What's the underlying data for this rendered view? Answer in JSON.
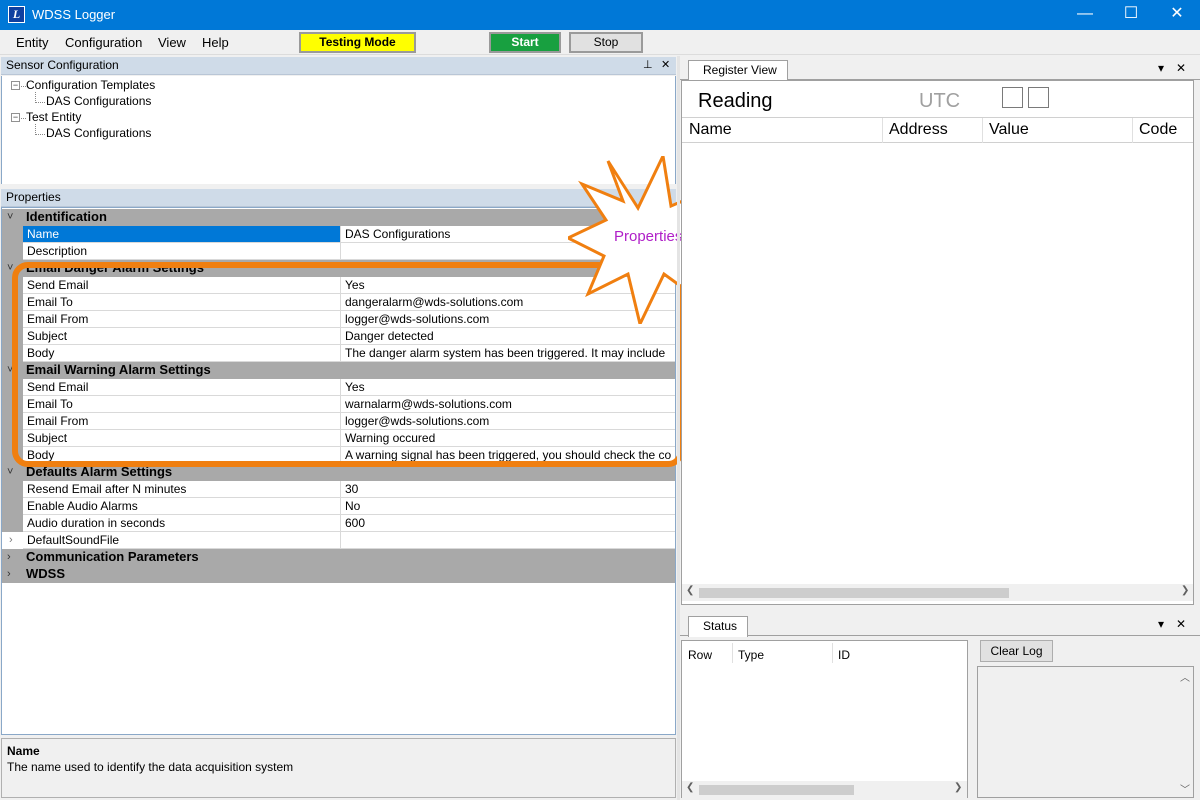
{
  "window": {
    "title": "WDSS Logger",
    "icon_letter": "L",
    "minimize_glyph": "—",
    "maximize_glyph": "☐",
    "close_glyph": "✕"
  },
  "menu": {
    "items": [
      "Entity",
      "Configuration",
      "View",
      "Help"
    ]
  },
  "toolbar": {
    "testing_mode_label": "Testing Mode",
    "testing_mode_color": "#ffff00",
    "start_label": "Start",
    "start_color": "#18a040",
    "stop_label": "Stop"
  },
  "sensor_config": {
    "title": "Sensor Configuration",
    "pin_glyph": "📌",
    "close_glyph": "✕",
    "tree": [
      {
        "label": "Configuration Templates",
        "expanded": true,
        "children": [
          "DAS Configurations"
        ]
      },
      {
        "label": "Test Entity",
        "expanded": true,
        "children": [
          "DAS Configurations"
        ]
      }
    ]
  },
  "properties": {
    "title": "Properties",
    "categories": [
      {
        "name": "Identification",
        "rows": [
          {
            "name": "Name",
            "value": "DAS Configurations",
            "selected": true
          },
          {
            "name": "Description",
            "value": ""
          }
        ]
      },
      {
        "name": "Email Danger Alarm Settings",
        "rows": [
          {
            "name": "Send Email",
            "value": "Yes"
          },
          {
            "name": "Email To",
            "value": "dangeralarm@wds-solutions.com"
          },
          {
            "name": "Email From",
            "value": "logger@wds-solutions.com"
          },
          {
            "name": "Subject",
            "value": "Danger detected"
          },
          {
            "name": "Body",
            "value": "The danger alarm system has been triggered. It may include"
          }
        ]
      },
      {
        "name": "Email Warning Alarm Settings",
        "rows": [
          {
            "name": "Send Email",
            "value": "Yes"
          },
          {
            "name": "Email To",
            "value": "warnalarm@wds-solutions.com"
          },
          {
            "name": "Email From",
            "value": "logger@wds-solutions.com"
          },
          {
            "name": "Subject",
            "value": "Warning occured"
          },
          {
            "name": "Body",
            "value": "A warning signal has been triggered, you should check the co"
          }
        ]
      },
      {
        "name": "Defaults Alarm Settings",
        "rows": [
          {
            "name": "Resend Email after N minutes",
            "value": "30"
          },
          {
            "name": "Enable Audio Alarms",
            "value": "No"
          },
          {
            "name": "Audio duration in seconds",
            "value": "600"
          },
          {
            "name": "DefaultSoundFile",
            "value": "",
            "expandable": true
          }
        ]
      },
      {
        "name": "Communication Parameters",
        "collapsed": true,
        "rows": []
      },
      {
        "name": "WDSS",
        "collapsed": true,
        "rows": []
      }
    ],
    "annotation_label": "Properties",
    "annotation_color": "#f07f10",
    "annotation_text_color": "#b020c8",
    "description": {
      "title": "Name",
      "text": "The name used to identify the data acquisition system"
    }
  },
  "register_view": {
    "tab_label": "Register View",
    "reading_label": "Reading",
    "utc_label": "UTC",
    "columns": [
      "Name",
      "Address",
      "Value",
      "Code"
    ],
    "dropdown_glyph": "▾",
    "close_glyph": "✕"
  },
  "status": {
    "tab_label": "Status",
    "columns": [
      "Row",
      "Type",
      "ID"
    ],
    "clear_log_label": "Clear Log",
    "dropdown_glyph": "▾",
    "close_glyph": "✕"
  }
}
